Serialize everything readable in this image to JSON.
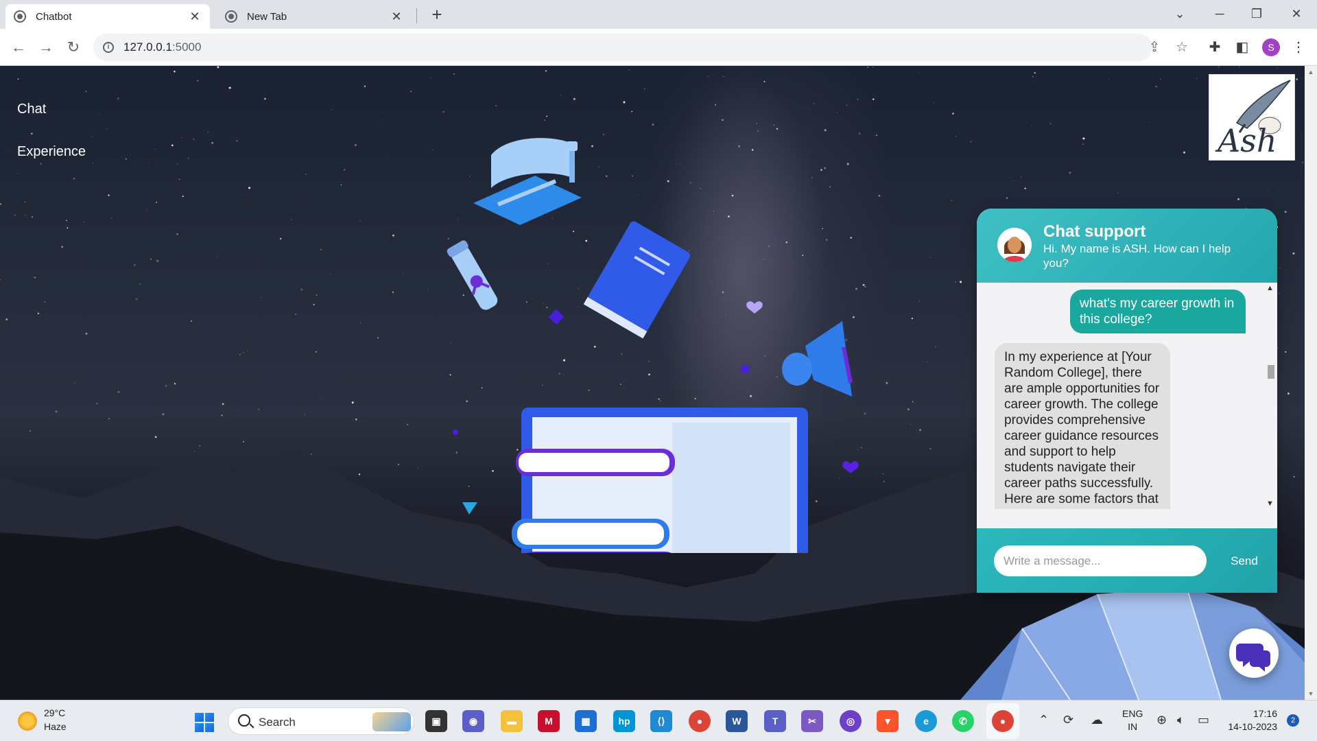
{
  "browser": {
    "tabs": [
      {
        "title": "Chatbot",
        "active": true
      },
      {
        "title": "New Tab",
        "active": false
      }
    ],
    "url_host": "127.0.0.1",
    "url_port": ":5000",
    "profile_initial": "S"
  },
  "page": {
    "nav": [
      {
        "label": "Chat"
      },
      {
        "label": "Experience"
      }
    ],
    "logo_text": "Ash"
  },
  "chat": {
    "header_title": "Chat support",
    "header_subtitle": "Hi. My name is ASH. How can I help you?",
    "messages": [
      {
        "from": "user",
        "text": "what's my career growth in this college?"
      },
      {
        "from": "bot",
        "text": "In my experience at [Your Random College], there are ample opportunities for career growth. The college provides comprehensive career guidance resources and support to help students navigate their career paths successfully. Here are some factors that"
      }
    ],
    "input_placeholder": "Write a message...",
    "send_label": "Send"
  },
  "taskbar": {
    "weather_temp": "29°C",
    "weather_desc": "Haze",
    "search_label": "Search",
    "lang_line1": "ENG",
    "lang_line2": "IN",
    "time": "17:16",
    "date": "14-10-2023",
    "notification_count": "2"
  },
  "colors": {
    "chat_accent": "#24a6ad",
    "user_bubble": "#1aa79d",
    "hero_blue": "#2f5be8",
    "hero_purple": "#5a22e0"
  }
}
